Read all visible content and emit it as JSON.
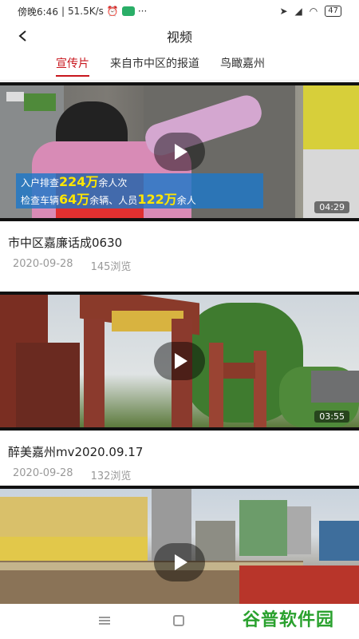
{
  "status_bar": {
    "time": "傍晚6:46",
    "speed": "51.5K/s",
    "dots": "···",
    "battery": "47"
  },
  "header": {
    "title": "视频"
  },
  "tabs": [
    {
      "label": "宣传片",
      "active": true
    },
    {
      "label": "来自市中区的报道",
      "active": false
    },
    {
      "label": "鸟瞰嘉州",
      "active": false
    }
  ],
  "videos": [
    {
      "title": "市中区嘉廉话成0630",
      "date": "2020-09-28",
      "views": "145浏览",
      "duration": "04:29",
      "caption_line1": {
        "prefix": "入户排查",
        "number": "224万",
        "suffix": "余人次"
      },
      "caption_line2": {
        "prefix": "检查车辆",
        "number1": "64万",
        "middle": "余辆、人员",
        "number2": "122万",
        "suffix": "余人"
      }
    },
    {
      "title": "醉美嘉州mv2020.09.17",
      "date": "2020-09-28",
      "views": "132浏览",
      "duration": "03:55"
    },
    {
      "title": "",
      "date": "",
      "views": "",
      "duration": ""
    }
  ],
  "watermark": "谷普软件园",
  "colors": {
    "accent": "#c8161d",
    "watermark": "#2aa12e"
  }
}
